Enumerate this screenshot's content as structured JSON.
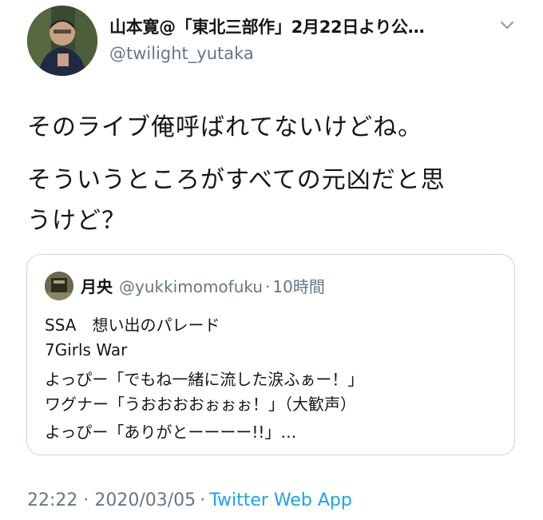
{
  "author": {
    "display_name": "山本寛@「東北三部作」2月22日より公…",
    "handle": "@twilight_yutaka",
    "avatar_icon": "user-avatar-photo"
  },
  "menu_icon": "chevron-down-icon",
  "tweet_text": {
    "line1": "そのライブ俺呼ばれてないけどね。",
    "line2": "そういうところがすべての元凶だと思",
    "line3": "うけど？"
  },
  "quoted_tweet": {
    "name": "月央",
    "handle": "@yukkimomofuku",
    "separator": "·",
    "time": "10時間",
    "lines": [
      "SSA　想い出のパレード",
      "7Girls War",
      "よっぴー「でもね一緒に流した涙ふぁー！」",
      "ワグナー「うおおおおぉぉぉ！」（大歓声）",
      "よっぴー「ありがとーーーー!!」…"
    ]
  },
  "meta": {
    "timestamp": "22:22 · 2020/03/05",
    "separator": "·",
    "source": "Twitter Web App"
  },
  "colors": {
    "text": "#14171a",
    "secondary": "#657786",
    "link": "#1da1f2",
    "border": "#ccd6dd"
  }
}
